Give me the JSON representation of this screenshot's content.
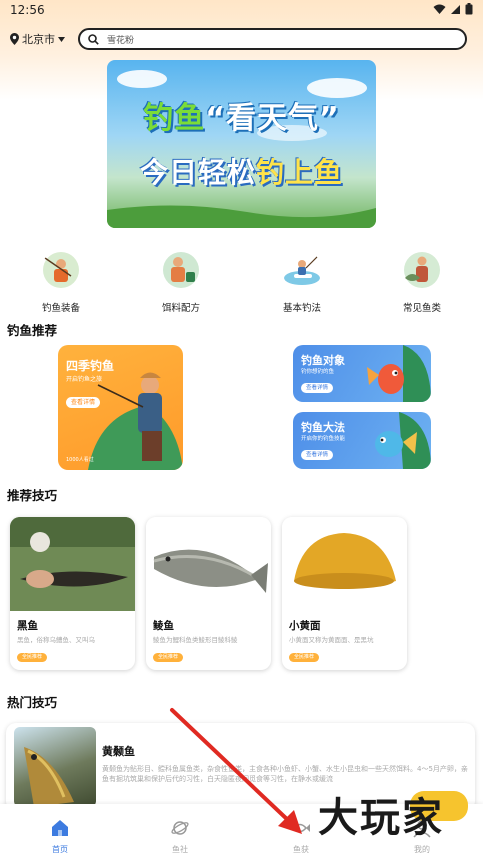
{
  "status_bar": {
    "time": "12:56"
  },
  "header": {
    "location": "北京市",
    "search_placeholder": "雪花粉"
  },
  "banner": {
    "line1_accent": "钓鱼",
    "line1_rest": "“看天气”",
    "line2_main": "今日轻松",
    "line2_accent": "钓上鱼"
  },
  "categories": [
    {
      "label": "钓鱼装备"
    },
    {
      "label": "饵料配方"
    },
    {
      "label": "基本钓法"
    },
    {
      "label": "常见鱼类"
    }
  ],
  "recommend": {
    "title": "钓鱼推荐",
    "main_card": {
      "title": "四季钓鱼",
      "subtitle": "开启钓鱼之旅",
      "button": "查看详情",
      "count": "1000人看过"
    },
    "side_cards": [
      {
        "title": "钓鱼对象",
        "subtitle": "钓你想钓的鱼",
        "button": "查看详情"
      },
      {
        "title": "钓鱼大法",
        "subtitle": "开启你的钓鱼技能",
        "button": "查看详情"
      }
    ]
  },
  "tips": {
    "title": "推荐技巧",
    "items": [
      {
        "name": "黑鱼",
        "desc": "黑鱼，俗称乌鳢鱼、又叫乌",
        "badge": "全民推荐"
      },
      {
        "name": "鲮鱼",
        "desc": "鲮鱼为鲤科鱼类鲮形目鲮科鲮",
        "badge": "全民推荐"
      },
      {
        "name": "小黄面",
        "desc": "小黄面又称为黄面面、是黑坑",
        "badge": "全民推荐"
      }
    ]
  },
  "hot": {
    "title": "热门技巧",
    "item": {
      "name": "黄颡鱼",
      "desc": "黄颡鱼为鲇形目、鲿科鱼属鱼类，杂食性鱼类，主食各种小鱼虾、小蟹、水生小昆虫和一些天然饵料。4～5月产卵，亲鱼有掘坑筑巢和保护后代的习性，白天隐匿夜间觅食等习性，在静水或缓流"
    }
  },
  "tab_bar": {
    "items": [
      {
        "label": "首页",
        "active": true
      },
      {
        "label": "鱼社",
        "active": false
      },
      {
        "label": "鱼获",
        "active": false
      },
      {
        "label": "我的",
        "active": false
      }
    ]
  },
  "watermark": "大玩家"
}
